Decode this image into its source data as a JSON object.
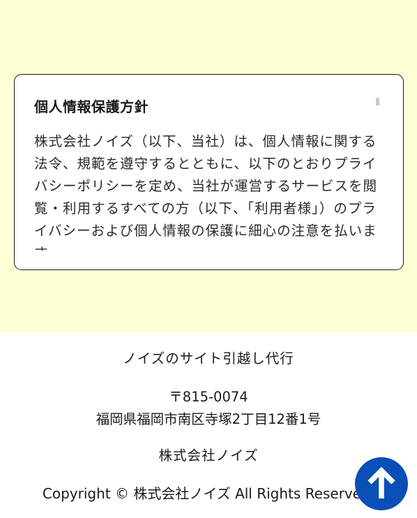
{
  "policy": {
    "title": "個人情報保護方針",
    "body": "株式会社ノイズ（以下、当社）は、個人情報に関する法令、規範を遵守するとともに、以下のとおりプライバシーポリシーを定め、当社が運営するサービスを閲覧・利用するすべての方（以下、「利用者様」）のプライバシーおよび個人情報の保護に細心の注意を払います。"
  },
  "footer": {
    "site_name": "ノイズのサイト引越し代行",
    "postal_code": "〒815-0074",
    "address": "福岡県福岡市南区寺塚2丁目12番1号",
    "company": "株式会社ノイズ",
    "copyright": "Copyright © 株式会社ノイズ All Rights Reserved."
  },
  "back_to_top": {
    "icon": "arrow-up-icon"
  },
  "colors": {
    "band_background": "#ffffd6",
    "button_blue": "#0a4fb8"
  }
}
